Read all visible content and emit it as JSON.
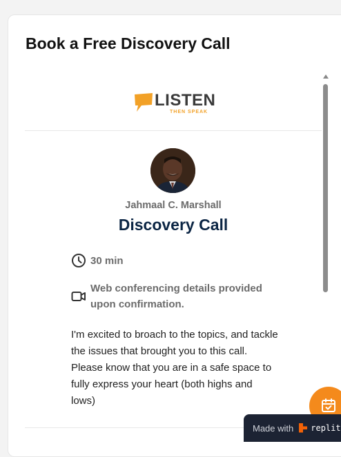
{
  "page": {
    "title": "Book a Free Discovery Call"
  },
  "logo": {
    "word": "LISTEN",
    "tagline": "THEN SPEAK",
    "accent": "#f2a127"
  },
  "host": {
    "name": "Jahmaal C. Marshall"
  },
  "event": {
    "name": "Discovery Call",
    "duration": "30 min",
    "location": "Web conferencing details provided upon confirmation.",
    "description": "I'm excited to broach to the topics, and tackle the issues that brought you to this call. Please know that you are in a safe space to fully express your heart (both highs and lows)"
  },
  "icons": {
    "duration": "clock-icon",
    "location": "video-camera-icon",
    "fab": "calendar-check-icon",
    "badge": "replit-logo-icon"
  },
  "badge": {
    "made_with": "Made with",
    "brand": "replit"
  },
  "colors": {
    "event_title": "#0b2544",
    "fab": "#f48a1c",
    "badge_bg": "#1c2333"
  }
}
